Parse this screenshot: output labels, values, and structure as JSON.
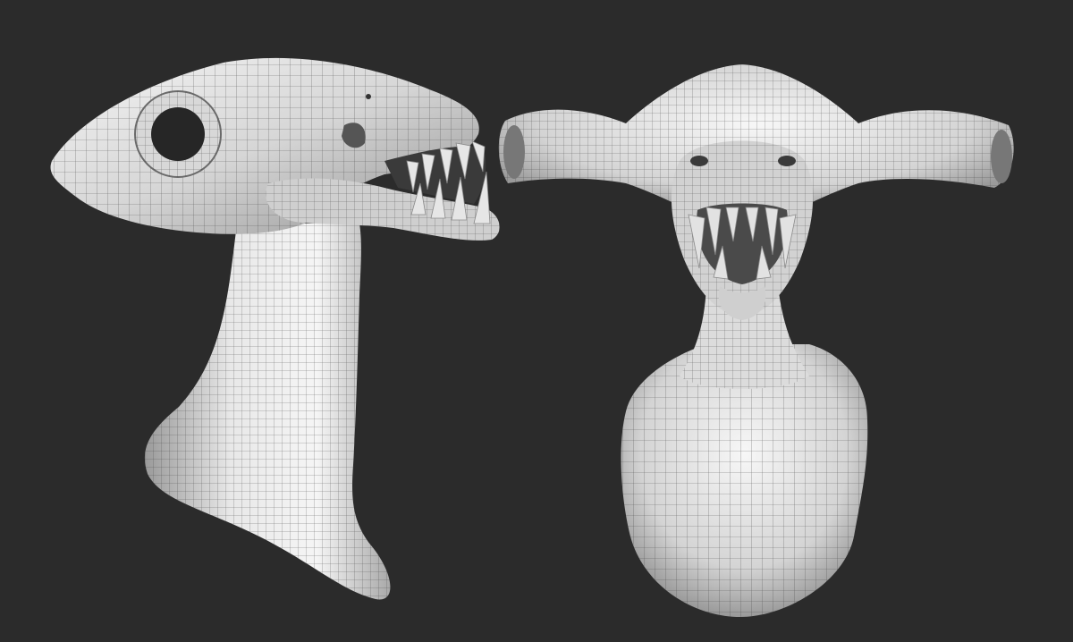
{
  "scene": {
    "background_color": "#2b2b2b",
    "mesh_base_color": "#d9d9d9",
    "mesh_highlight_color": "#f2f2f2",
    "mesh_shadow_color": "#8a8a8a",
    "wire_color": "#3a3a3a",
    "views": [
      {
        "name": "side-view",
        "subject": "creature-head-sculpt"
      },
      {
        "name": "front-view",
        "subject": "creature-head-sculpt"
      }
    ]
  }
}
